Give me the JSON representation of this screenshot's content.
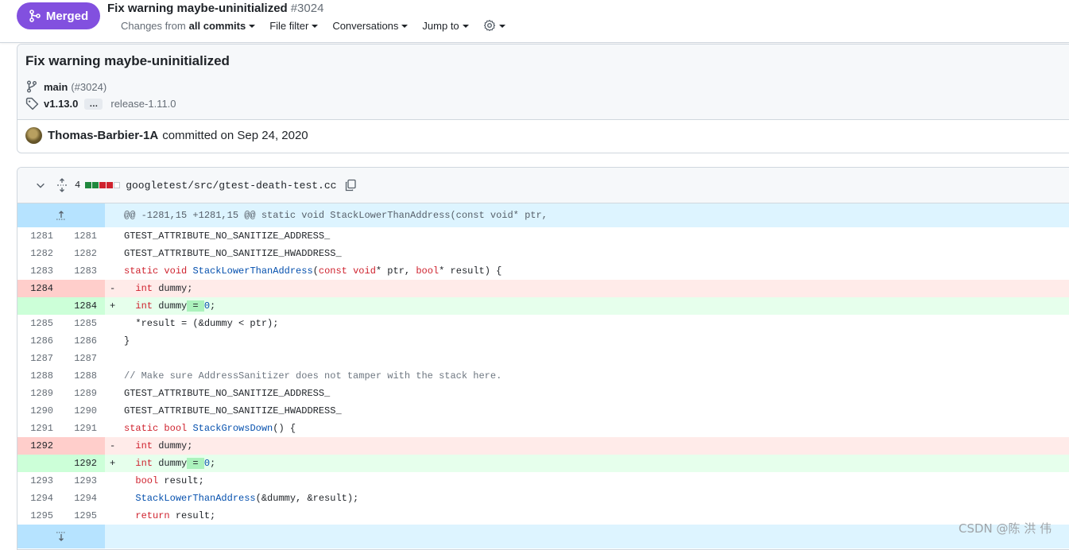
{
  "header": {
    "badge_label": "Merged",
    "title": "Fix warning maybe-uninitialized",
    "number": "#3024",
    "changes_prefix": "Changes from",
    "changes_value": "all commits",
    "file_filter": "File filter",
    "conversations": "Conversations",
    "jump_to": "Jump to"
  },
  "commit": {
    "title": "Fix warning maybe-uninitialized",
    "branch": "main",
    "branch_pr": "(#3024)",
    "tag": "v1.13.0",
    "tag_more": "…",
    "release": "release-1.11.0",
    "author": "Thomas-Barbier-1A",
    "committed_text": "committed on Sep 24, 2020"
  },
  "file": {
    "change_count": "4",
    "path": "googletest/src/gtest-death-test.cc",
    "hunk_header": "@@ -1281,15 +1281,15 @@ static void StackLowerThanAddress(const void* ptr,",
    "lines": [
      {
        "old": "1281",
        "new": "1281",
        "sign": "",
        "type": "ctx",
        "code": "GTEST_ATTRIBUTE_NO_SANITIZE_ADDRESS_"
      },
      {
        "old": "1282",
        "new": "1282",
        "sign": "",
        "type": "ctx",
        "code": "GTEST_ATTRIBUTE_NO_SANITIZE_HWADDRESS_"
      },
      {
        "old": "1283",
        "new": "1283",
        "sign": "",
        "type": "ctx",
        "code": "static void StackLowerThanAddress(const void* ptr, bool* result) {"
      },
      {
        "old": "1284",
        "new": "",
        "sign": "-",
        "type": "del",
        "code": "  int dummy;"
      },
      {
        "old": "",
        "new": "1284",
        "sign": "+",
        "type": "add",
        "code": "  int dummy = 0;"
      },
      {
        "old": "1285",
        "new": "1285",
        "sign": "",
        "type": "ctx",
        "code": "  *result = (&dummy < ptr);"
      },
      {
        "old": "1286",
        "new": "1286",
        "sign": "",
        "type": "ctx",
        "code": "}"
      },
      {
        "old": "1287",
        "new": "1287",
        "sign": "",
        "type": "ctx",
        "code": ""
      },
      {
        "old": "1288",
        "new": "1288",
        "sign": "",
        "type": "ctx",
        "code": "// Make sure AddressSanitizer does not tamper with the stack here."
      },
      {
        "old": "1289",
        "new": "1289",
        "sign": "",
        "type": "ctx",
        "code": "GTEST_ATTRIBUTE_NO_SANITIZE_ADDRESS_"
      },
      {
        "old": "1290",
        "new": "1290",
        "sign": "",
        "type": "ctx",
        "code": "GTEST_ATTRIBUTE_NO_SANITIZE_HWADDRESS_"
      },
      {
        "old": "1291",
        "new": "1291",
        "sign": "",
        "type": "ctx",
        "code": "static bool StackGrowsDown() {"
      },
      {
        "old": "1292",
        "new": "",
        "sign": "-",
        "type": "del",
        "code": "  int dummy;"
      },
      {
        "old": "",
        "new": "1292",
        "sign": "+",
        "type": "add",
        "code": "  int dummy = 0;"
      },
      {
        "old": "1293",
        "new": "1293",
        "sign": "",
        "type": "ctx",
        "code": "  bool result;"
      },
      {
        "old": "1294",
        "new": "1294",
        "sign": "",
        "type": "ctx",
        "code": "  StackLowerThanAddress(&dummy, &result);"
      },
      {
        "old": "1295",
        "new": "1295",
        "sign": "",
        "type": "ctx",
        "code": "  return result;"
      }
    ]
  },
  "watermark": "CSDN @陈 洪 伟",
  "colors": {
    "merged": "#8250df",
    "addition": "#1f883d",
    "deletion": "#cf222e",
    "hunk_bg": "#ddf4ff"
  },
  "icons": [
    "git-merge-icon",
    "chevron-down-icon",
    "gear-icon",
    "git-branch-icon",
    "tag-icon",
    "expand-icon",
    "copy-icon",
    "unfold-up-icon",
    "unfold-down-icon"
  ]
}
